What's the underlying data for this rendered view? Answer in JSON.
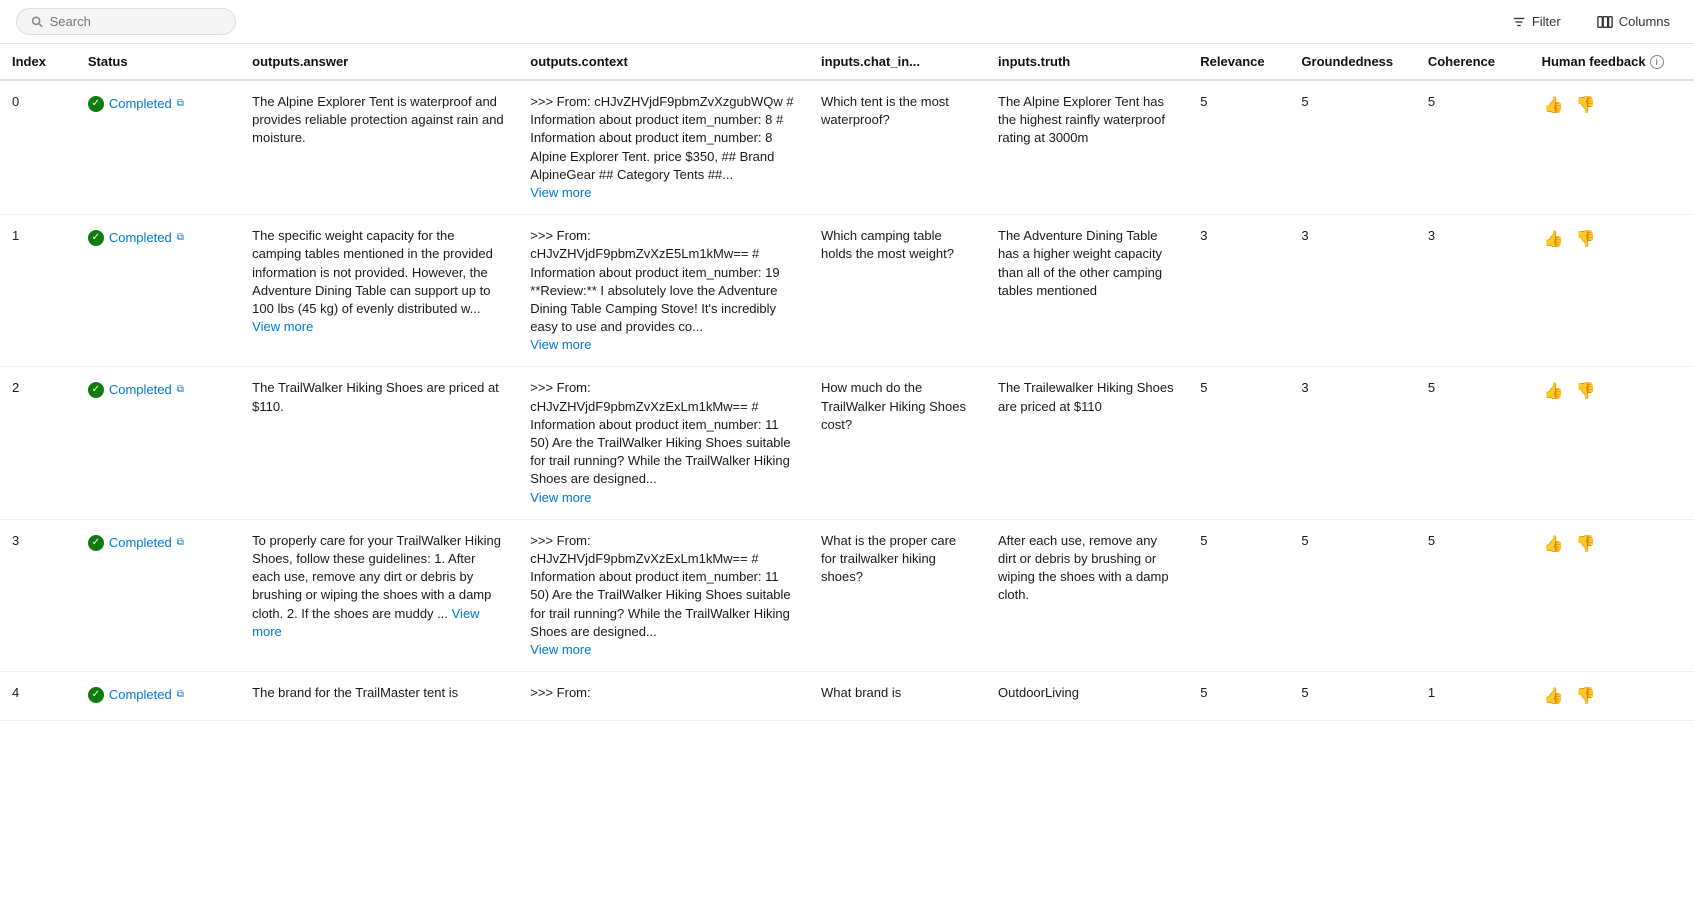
{
  "toolbar": {
    "search_placeholder": "Search",
    "filter_label": "Filter",
    "columns_label": "Columns"
  },
  "table": {
    "columns": [
      {
        "key": "index",
        "label": "Index"
      },
      {
        "key": "status",
        "label": "Status"
      },
      {
        "key": "answer",
        "label": "outputs.answer"
      },
      {
        "key": "context",
        "label": "outputs.context"
      },
      {
        "key": "chat_in",
        "label": "inputs.chat_in..."
      },
      {
        "key": "truth",
        "label": "inputs.truth"
      },
      {
        "key": "relevance",
        "label": "Relevance"
      },
      {
        "key": "groundedness",
        "label": "Groundedness"
      },
      {
        "key": "coherence",
        "label": "Coherence"
      },
      {
        "key": "feedback",
        "label": "Human feedback"
      }
    ],
    "rows": [
      {
        "index": "0",
        "status": "Completed",
        "answer": "The Alpine Explorer Tent is waterproof and provides reliable protection against rain and moisture.",
        "context_short": ">>> From: cHJvZHVjdF9pbmZvXzgubWQw # Information about product item_number: 8 # Information about product item_number: 8 Alpine Explorer Tent. price $350, ## Brand AlpineGear ## Category Tents ##...",
        "context_has_more": true,
        "chat_in": "Which tent is the most waterproof?",
        "truth": "The Alpine Explorer Tent has the highest rainfly waterproof rating at 3000m",
        "relevance": "5",
        "groundedness": "5",
        "coherence": "5"
      },
      {
        "index": "1",
        "status": "Completed",
        "answer": "The specific weight capacity for the camping tables mentioned in the provided information is not provided. However, the Adventure Dining Table can support up to 100 lbs (45 kg) of evenly distributed w...",
        "answer_has_more": true,
        "context_short": ">>> From: cHJvZHVjdF9pbmZvXzE5Lm1kMw== # Information about product item_number: 19 **Review:** I absolutely love the Adventure Dining Table Camping Stove! It's incredibly easy to use and provides co...",
        "context_has_more": true,
        "chat_in": "Which camping table holds the most weight?",
        "truth": "The Adventure Dining Table has a higher weight capacity than all of the other camping tables mentioned",
        "relevance": "3",
        "groundedness": "3",
        "coherence": "3"
      },
      {
        "index": "2",
        "status": "Completed",
        "answer": "The TrailWalker Hiking Shoes are priced at $110.",
        "context_short": ">>> From: cHJvZHVjdF9pbmZvXzExLm1kMw== # Information about product item_number: 11 50) Are the TrailWalker Hiking Shoes suitable for trail running? While the TrailWalker Hiking Shoes are designed...",
        "context_has_more": true,
        "chat_in": "How much do the TrailWalker Hiking Shoes cost?",
        "truth": "The Trailewalker Hiking Shoes are priced at $110",
        "relevance": "5",
        "groundedness": "3",
        "coherence": "5"
      },
      {
        "index": "3",
        "status": "Completed",
        "answer": "To properly care for your TrailWalker Hiking Shoes, follow these guidelines: 1. After each use, remove any dirt or debris by brushing or wiping the shoes with a damp cloth. 2. If the shoes are muddy ...",
        "answer_has_more": true,
        "context_short": ">>> From: cHJvZHVjdF9pbmZvXzExLm1kMw== # Information about product item_number: 11 50) Are the TrailWalker Hiking Shoes suitable for trail running? While the TrailWalker Hiking Shoes are designed...",
        "context_has_more": true,
        "chat_in": "What is the proper care for trailwalker hiking shoes?",
        "truth": "After each use, remove any dirt or debris by brushing or wiping the shoes with a damp cloth.",
        "relevance": "5",
        "groundedness": "5",
        "coherence": "5"
      },
      {
        "index": "4",
        "status": "Completed",
        "answer": "The brand for the TrailMaster tent is",
        "context_short": ">>> From:",
        "context_has_more": false,
        "chat_in": "What brand is",
        "truth": "OutdoorLiving",
        "relevance": "5",
        "groundedness": "5",
        "coherence": "1"
      }
    ]
  }
}
